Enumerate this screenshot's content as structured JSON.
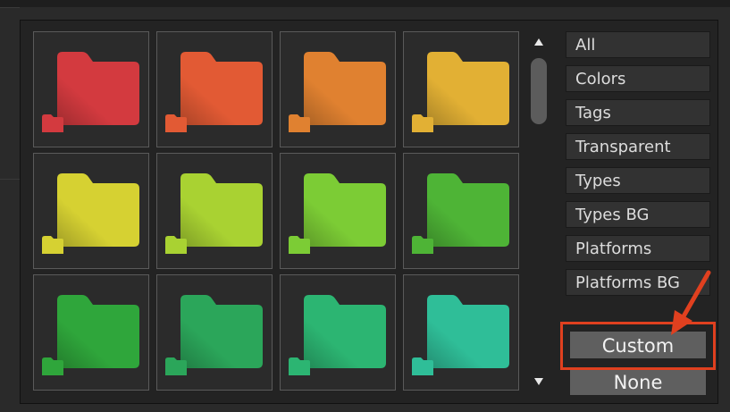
{
  "folders": [
    {
      "color": "#d33a3f",
      "name": "red"
    },
    {
      "color": "#e25a34",
      "name": "orange-red"
    },
    {
      "color": "#e08130",
      "name": "orange"
    },
    {
      "color": "#e2b034",
      "name": "amber"
    },
    {
      "color": "#d6d132",
      "name": "yellow"
    },
    {
      "color": "#a9d232",
      "name": "yellow-green"
    },
    {
      "color": "#7ccc35",
      "name": "light-green"
    },
    {
      "color": "#4eb436",
      "name": "green"
    },
    {
      "color": "#2fa63b",
      "name": "medium-green"
    },
    {
      "color": "#2ba65a",
      "name": "emerald"
    },
    {
      "color": "#2cb572",
      "name": "sea-green"
    },
    {
      "color": "#2fbe98",
      "name": "teal"
    }
  ],
  "categories": [
    "All",
    "Colors",
    "Tags",
    "Transparent",
    "Types",
    "Types BG",
    "Platforms",
    "Platforms BG"
  ],
  "buttons": {
    "custom": "Custom",
    "none": "None"
  },
  "annotation_color": "#e0401f",
  "icons": {
    "scroll_up": "triangle-up",
    "scroll_down": "triangle-down",
    "folder": "folder-icon"
  }
}
